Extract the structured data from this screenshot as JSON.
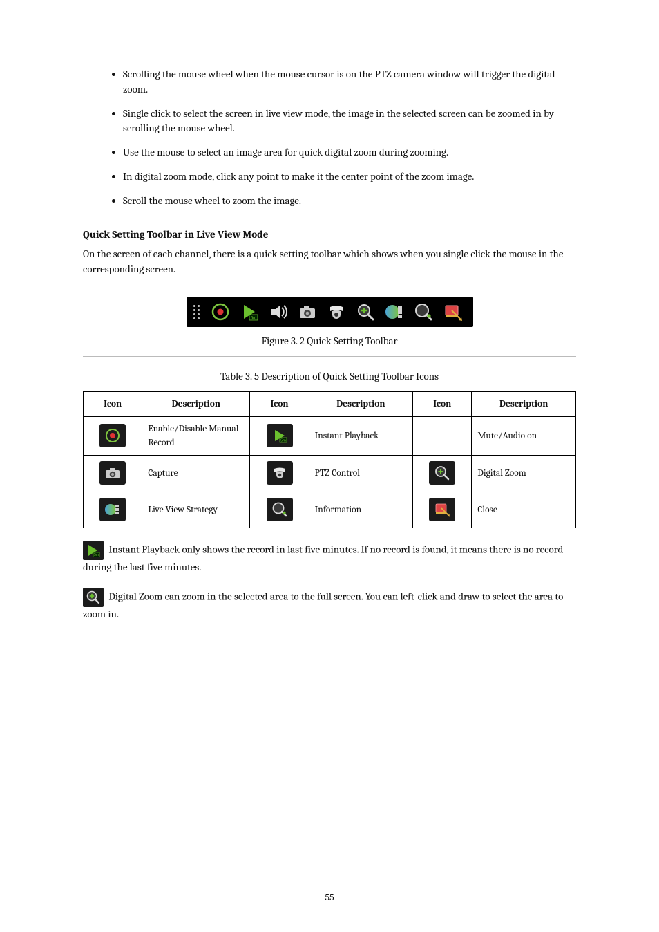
{
  "features": [
    "Scrolling the mouse wheel when the mouse cursor is on the PTZ camera window will trigger the digital zoom.",
    "Single click to select the screen in live view mode, the image in the selected screen can be zoomed in by scrolling the mouse wheel.",
    "Use the mouse to select an image area for quick digital zoom during zooming.",
    "In digital zoom mode, click any point to make it the center point of the zoom image.",
    "Scroll the mouse wheel to zoom the image."
  ],
  "quick_setting": {
    "title": "Quick Setting Toolbar in Live View Mode",
    "text": "On the screen of each channel, there is a quick setting toolbar which shows when you single click the mouse in the corresponding screen.",
    "figure_caption": "Figure 3. 2  Quick Setting Toolbar",
    "table_caption": "Table 3. 5  Description of Quick Setting Toolbar Icons"
  },
  "table": {
    "headers": [
      "Icon",
      "Description",
      "Icon",
      "Description",
      "Icon",
      "Description"
    ],
    "rows": [
      [
        {
          "icon": "record",
          "desc": "Enable/Disable Manual Record"
        },
        {
          "icon": "play5m",
          "desc": "Instant Playback"
        },
        {
          "icon": null,
          "desc": "Mute/Audio on"
        }
      ],
      [
        {
          "icon": "capture",
          "desc": "Capture"
        },
        {
          "icon": "ptz",
          "desc": "PTZ Control"
        },
        {
          "icon": "zoom",
          "desc": "Digital Zoom"
        }
      ],
      [
        {
          "icon": "strategy",
          "desc": "Live View Strategy"
        },
        {
          "icon": "info",
          "desc": "Information"
        },
        {
          "icon": "close",
          "desc": "Close"
        }
      ]
    ]
  },
  "inline_paragraphs": [
    {
      "icon": "play5m",
      "text": "Instant Playback only shows the record in last five minutes. If no record is found, it means there is no record during the last five minutes."
    },
    {
      "icon": "zoom",
      "text": "Digital Zoom can zoom in the selected area to the full screen. You can left-click and draw to select the area to zoom in."
    }
  ],
  "page_number": "55"
}
